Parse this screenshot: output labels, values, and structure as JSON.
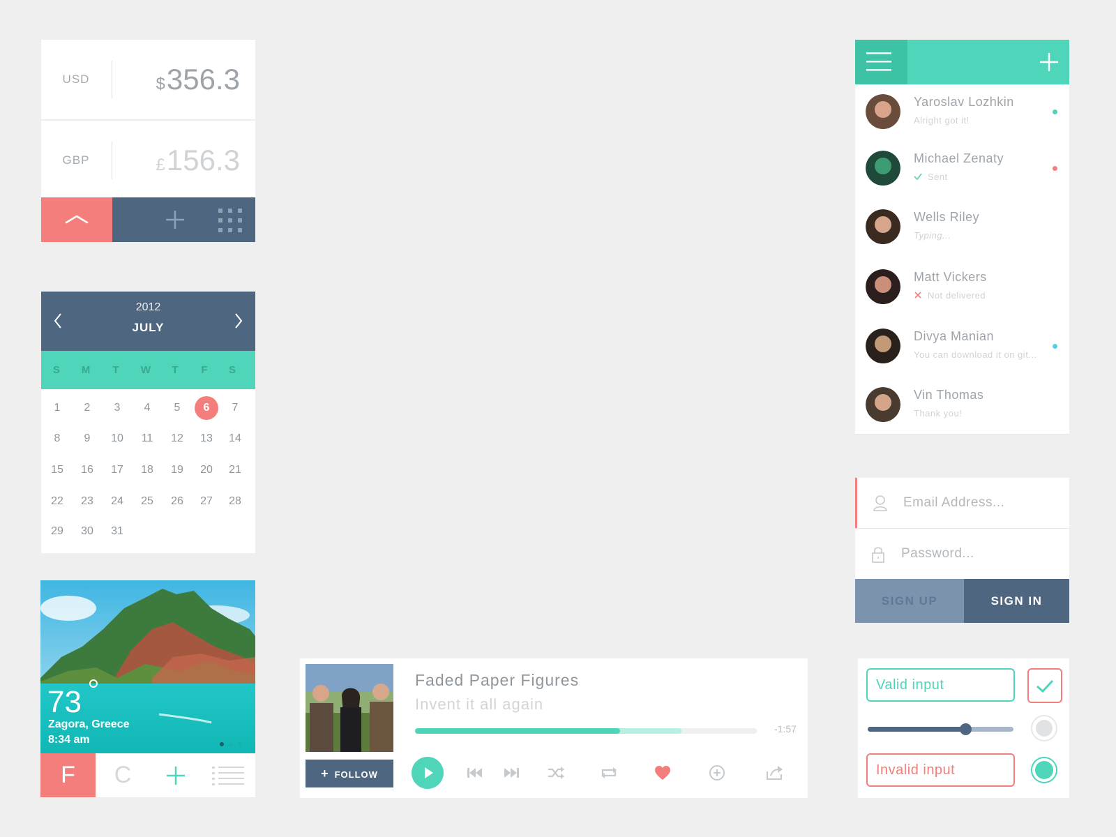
{
  "currency": {
    "rows": [
      {
        "code": "USD",
        "symbol": "$",
        "amount": "356.3"
      },
      {
        "code": "GBP",
        "symbol": "£",
        "amount": "156.3"
      }
    ],
    "toolbar_icons": [
      "chevron-up-icon",
      "plus-icon",
      "grid-icon"
    ]
  },
  "calendar": {
    "year": "2012",
    "month": "JULY",
    "weekdays": [
      "S",
      "M",
      "T",
      "W",
      "T",
      "F",
      "S"
    ],
    "days": [
      "1",
      "2",
      "3",
      "4",
      "5",
      "6",
      "7",
      "8",
      "9",
      "10",
      "11",
      "12",
      "13",
      "14",
      "15",
      "16",
      "17",
      "18",
      "19",
      "20",
      "21",
      "22",
      "23",
      "24",
      "25",
      "26",
      "27",
      "28",
      "29",
      "30",
      "31"
    ],
    "selected_day": "6"
  },
  "weather": {
    "temperature": "73",
    "location": "Zagora, Greece",
    "time": "8:34 am",
    "tabs": [
      "F",
      "C"
    ]
  },
  "player": {
    "artist": "Faded Paper Figures",
    "track": "Invent it all again",
    "remaining": "-1:57",
    "progress": 0.6,
    "buffered": 0.78,
    "follow_label": "FOLLOW"
  },
  "contacts": {
    "items": [
      {
        "name": "Yaroslav Lozhkin",
        "message": "Alright got it!",
        "status": "",
        "dot": "#4fd5ba"
      },
      {
        "name": "Michael Zenaty",
        "message": "Sent",
        "status": "sent",
        "dot": "#f47e7b"
      },
      {
        "name": "Wells Riley",
        "message": "Typing...",
        "status": "typing",
        "dot": ""
      },
      {
        "name": "Matt Vickers",
        "message": "Not delivered",
        "status": "failed",
        "dot": ""
      },
      {
        "name": "Divya Manian",
        "message": "You can download it on git...",
        "status": "",
        "dot": "#4fd3e8"
      },
      {
        "name": "Vin Thomas",
        "message": "Thank you!",
        "status": "",
        "dot": ""
      }
    ]
  },
  "login": {
    "email_placeholder": "Email Address...",
    "password_placeholder": "Password...",
    "sign_up": "SIGN UP",
    "sign_in": "SIGN IN"
  },
  "controls": {
    "valid_input": "Valid input",
    "invalid_input": "Invalid input",
    "slider_value": 0.67
  },
  "colors": {
    "teal": "#4fd5ba",
    "coral": "#f47e7b",
    "slate": "#4f6680",
    "background": "#efefef"
  }
}
